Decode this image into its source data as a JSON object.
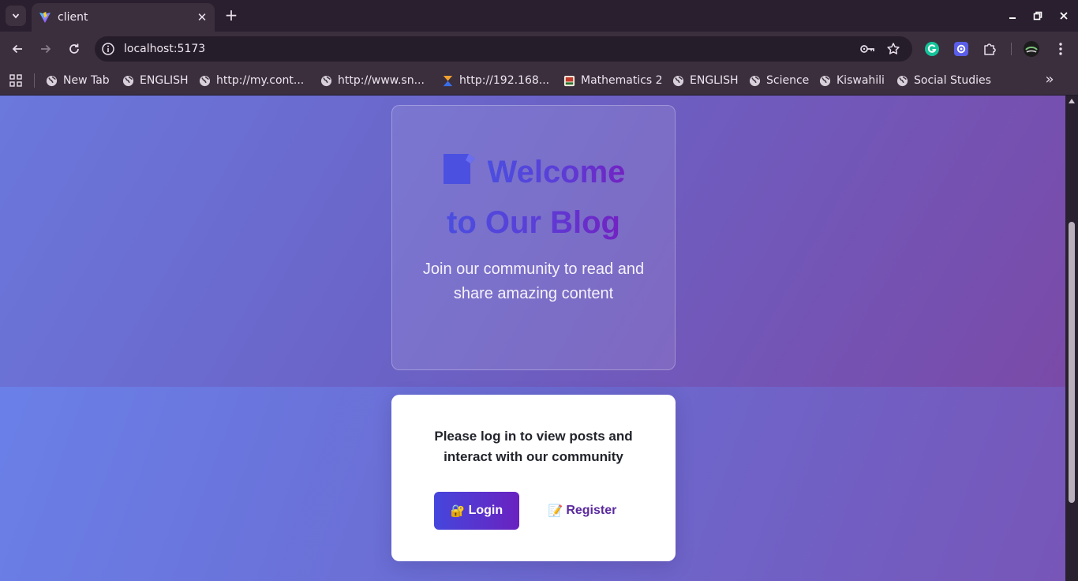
{
  "browser": {
    "tab_title": "client",
    "url": "localhost:5173",
    "bookmarks": [
      {
        "label": "New Tab",
        "icon": "globe-icon"
      },
      {
        "label": "ENGLISH",
        "icon": "globe-icon"
      },
      {
        "label": "http://my.cont...",
        "icon": "globe-icon"
      },
      {
        "label": "http://www.sn...",
        "icon": "globe-icon"
      },
      {
        "label": "http://192.168...",
        "icon": "hourglass-icon"
      },
      {
        "label": "Mathematics 2",
        "icon": "kicd-icon"
      },
      {
        "label": "ENGLISH",
        "icon": "globe-icon"
      },
      {
        "label": "Science",
        "icon": "globe-icon"
      },
      {
        "label": "Kiswahili",
        "icon": "globe-icon"
      },
      {
        "label": "Social Studies",
        "icon": "globe-icon"
      }
    ]
  },
  "hero": {
    "title_line1": "Welcome",
    "title_line2": "to Our Blog",
    "subtitle": "Join our community to read and share amazing content"
  },
  "login_card": {
    "message": "Please log in to view posts and interact with our community",
    "login_emoji": "🔐",
    "login_label": "Login",
    "register_emoji": "📝",
    "register_label": "Register"
  },
  "colors": {
    "accent": "#4546dc",
    "accent_end": "#6a22c0",
    "register_text": "#5b2a9e"
  }
}
